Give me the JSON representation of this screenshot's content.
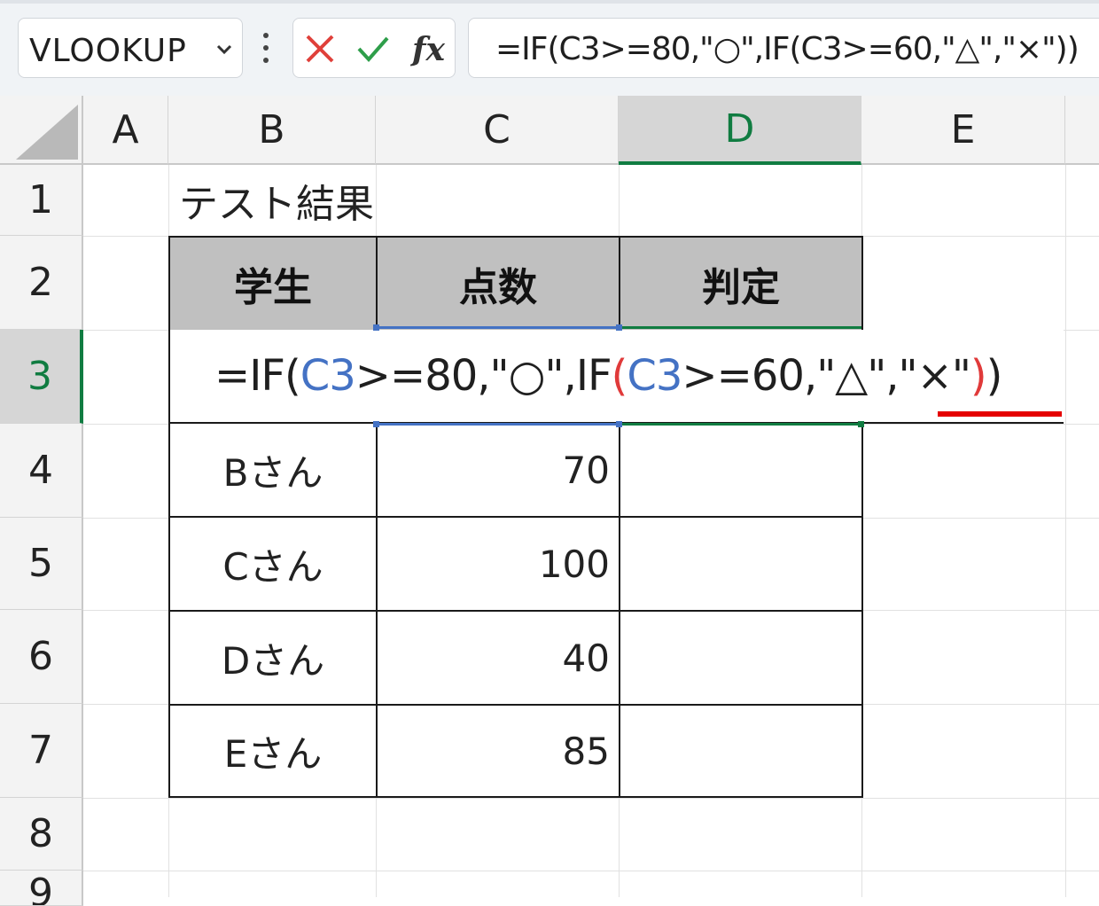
{
  "name_box": {
    "value": "VLOOKUP"
  },
  "formula_bar": {
    "value": "=IF(C3>=80,\"○\",IF(C3>=60,\"△\",\"×\"))"
  },
  "columns": [
    "A",
    "B",
    "C",
    "D",
    "E"
  ],
  "rows": [
    "1",
    "2",
    "3",
    "4",
    "5",
    "6",
    "7",
    "8",
    "9"
  ],
  "selected_column": "D",
  "selected_row": "3",
  "sheet": {
    "title": "テスト結果",
    "headers": [
      "学生",
      "点数",
      "判定"
    ],
    "records": [
      {
        "name": "Bさん",
        "score": "70",
        "result": ""
      },
      {
        "name": "Cさん",
        "score": "100",
        "result": ""
      },
      {
        "name": "Dさん",
        "score": "40",
        "result": ""
      },
      {
        "name": "Eさん",
        "score": "85",
        "result": ""
      }
    ]
  },
  "edit_formula": {
    "t1": "=IF(",
    "r1": "C3",
    "t2": ">=80,\"○\",IF",
    "p_open": "(",
    "r2": "C3",
    "t3": ">=60,\"△\",\"×\"",
    "p_close": ")",
    "t4": ")"
  },
  "colors": {
    "accent_green": "#107c41",
    "ref_blue": "#4472c4",
    "paren_red": "#e03a3a",
    "underline_red": "#e50000",
    "header_fill": "#c0c0c0"
  }
}
